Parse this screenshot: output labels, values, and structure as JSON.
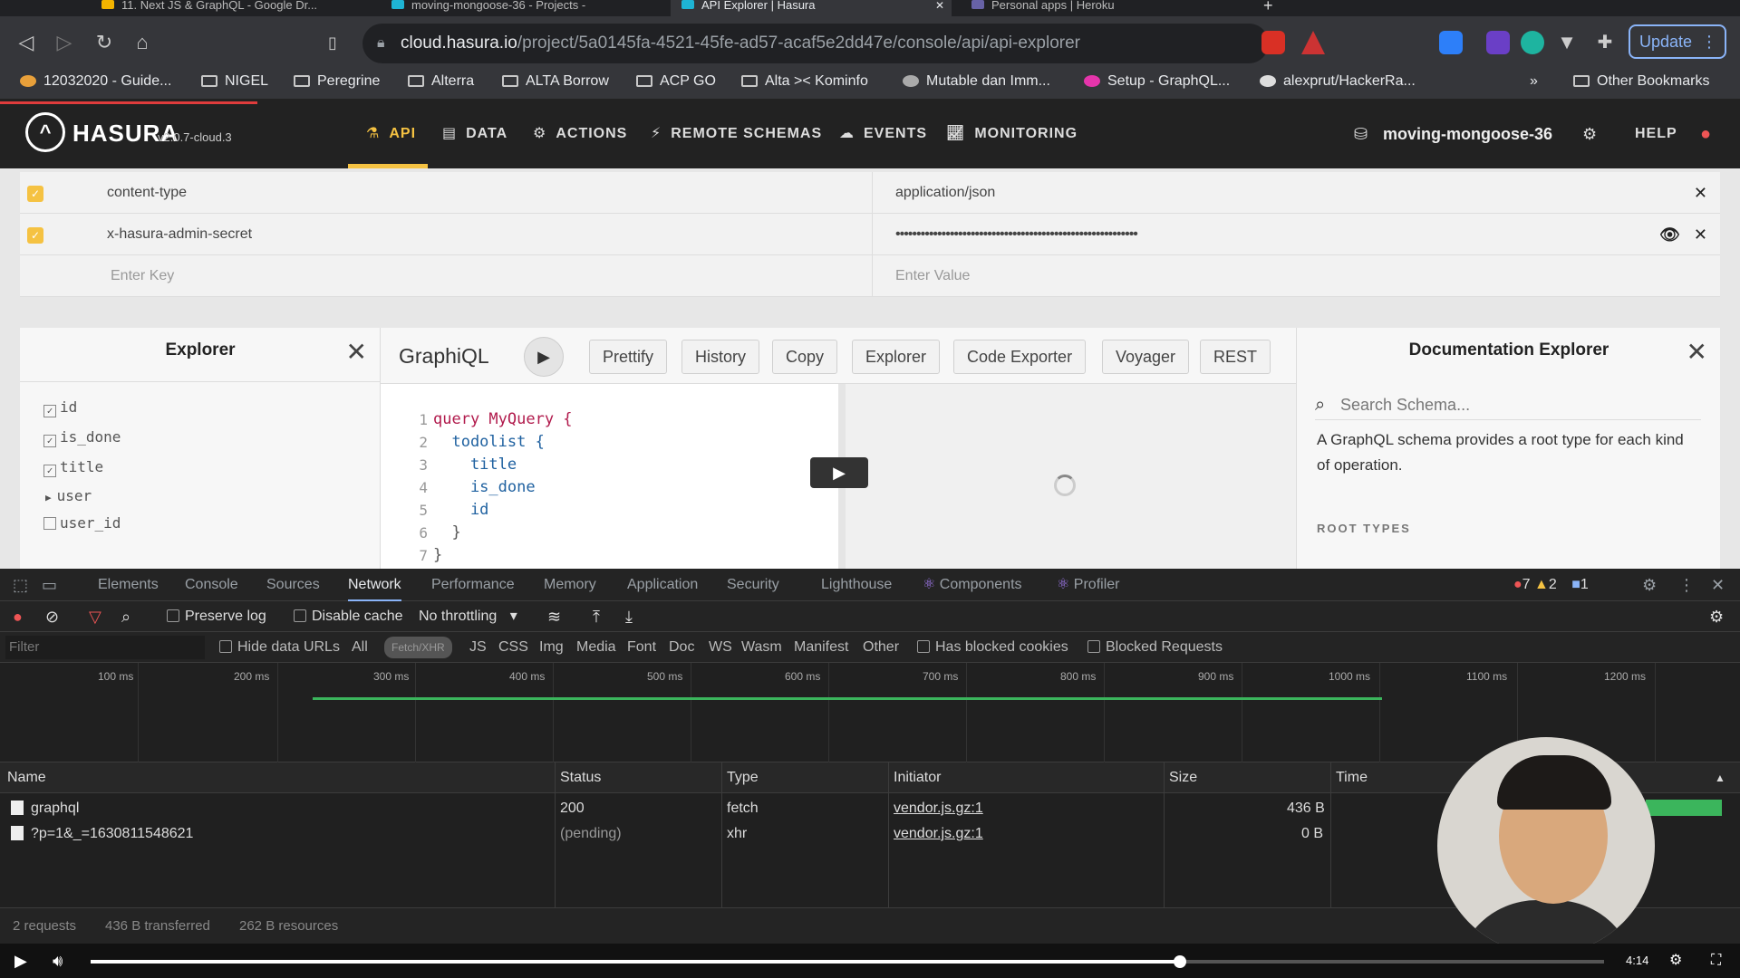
{
  "browser": {
    "tabs": [
      {
        "label": "11. Next JS & GraphQL - Google Dr...",
        "active": false
      },
      {
        "label": "moving-mongoose-36 - Projects -",
        "active": false
      },
      {
        "label": "API Explorer | Hasura",
        "active": true
      },
      {
        "label": "Personal apps | Heroku",
        "active": false
      }
    ],
    "url_host": "cloud.hasura.io",
    "url_path": "/project/5a0145fa-4521-45fe-ad57-acaf5e2dd47e/console/api/api-explorer",
    "update_label": "Update",
    "bookmarks": [
      "12032020 - Guide...",
      "NIGEL",
      "Peregrine",
      "Alterra",
      "ALTA Borrow",
      "ACP GO",
      "Alta >< Kominfo",
      "Mutable dan Imm...",
      "Setup - GraphQL...",
      "alexprut/HackerRa..."
    ],
    "more_bookmarks": "»",
    "other_bookmarks": "Other Bookmarks"
  },
  "hasura": {
    "logo_text": "HASURA",
    "version": "v2.0.7-cloud.3",
    "nav": [
      {
        "label": "API",
        "icon": "flask-icon",
        "active": true
      },
      {
        "label": "DATA",
        "icon": "database-icon",
        "active": false
      },
      {
        "label": "ACTIONS",
        "icon": "gears-icon",
        "active": false
      },
      {
        "label": "REMOTE SCHEMAS",
        "icon": "plug-icon",
        "active": false
      },
      {
        "label": "EVENTS",
        "icon": "cloud-icon",
        "active": false
      },
      {
        "label": "MONITORING",
        "icon": "chart-icon",
        "active": false
      }
    ],
    "project_name": "moving-mongoose-36",
    "help_label": "HELP",
    "accent_color": "#f5c242"
  },
  "headers": [
    {
      "key": "content-type",
      "value": "application/json",
      "checked": true
    },
    {
      "key": "x-hasura-admin-secret",
      "value": "••••••••••••••••••••••••••••••••••••••••••••••••••••••••••",
      "checked": true
    }
  ],
  "headers_new": {
    "key_placeholder": "Enter Key",
    "value_placeholder": "Enter Value"
  },
  "explorer": {
    "title": "Explorer",
    "fields": [
      {
        "name": "id",
        "checked": true
      },
      {
        "name": "is_done",
        "checked": true
      },
      {
        "name": "title",
        "checked": true
      },
      {
        "name": "user",
        "expandable": true
      },
      {
        "name": "user_id",
        "checked": false
      }
    ]
  },
  "graphiql": {
    "title": "GraphiQL",
    "toolbar": [
      "Prettify",
      "History",
      "Copy",
      "Explorer",
      "Code Exporter",
      "Voyager",
      "REST"
    ],
    "code_lines": [
      {
        "n": "1",
        "text": "query MyQuery {"
      },
      {
        "n": "2",
        "text": "  todolist {"
      },
      {
        "n": "3",
        "text": "    title"
      },
      {
        "n": "4",
        "text": "    is_done"
      },
      {
        "n": "5",
        "text": "    id"
      },
      {
        "n": "6",
        "text": "  }"
      },
      {
        "n": "7",
        "text": "}"
      }
    ]
  },
  "docs": {
    "title": "Documentation Explorer",
    "search_placeholder": "Search Schema...",
    "description": "A GraphQL schema provides a root type for each kind of operation.",
    "root_types": "ROOT TYPES"
  },
  "devtools": {
    "tabs": [
      "Elements",
      "Console",
      "Sources",
      "Network",
      "Performance",
      "Memory",
      "Application",
      "Security",
      "Lighthouse",
      "Components",
      "Profiler"
    ],
    "active_tab": "Network",
    "errors": "7",
    "warnings": "2",
    "messages": "1",
    "preserve_log": "Preserve log",
    "disable_cache": "Disable cache",
    "throttling": "No throttling",
    "filter_placeholder": "Filter",
    "hide_data_urls": "Hide data URLs",
    "filter_types": [
      "All",
      "Fetch/XHR",
      "JS",
      "CSS",
      "Img",
      "Media",
      "Font",
      "Doc",
      "WS",
      "Wasm",
      "Manifest",
      "Other"
    ],
    "has_blocked_cookies": "Has blocked cookies",
    "blocked_requests": "Blocked Requests",
    "timeline_ticks": [
      "100 ms",
      "200 ms",
      "300 ms",
      "400 ms",
      "500 ms",
      "600 ms",
      "700 ms",
      "800 ms",
      "900 ms",
      "1000 ms",
      "1100 ms",
      "1200 ms"
    ],
    "columns": [
      "Name",
      "Status",
      "Type",
      "Initiator",
      "Size",
      "Time"
    ],
    "rows": [
      {
        "name": "graphql",
        "status": "200",
        "type": "fetch",
        "initiator": "vendor.js.gz:1",
        "size": "436 B"
      },
      {
        "name": "?p=1&_=1630811548621",
        "status": "(pending)",
        "type": "xhr",
        "initiator": "vendor.js.gz:1",
        "size": "0 B"
      }
    ],
    "summary": [
      "2 requests",
      "436 B transferred",
      "262 B resources"
    ]
  },
  "video": {
    "time": "4:14",
    "progress": 0.72
  }
}
